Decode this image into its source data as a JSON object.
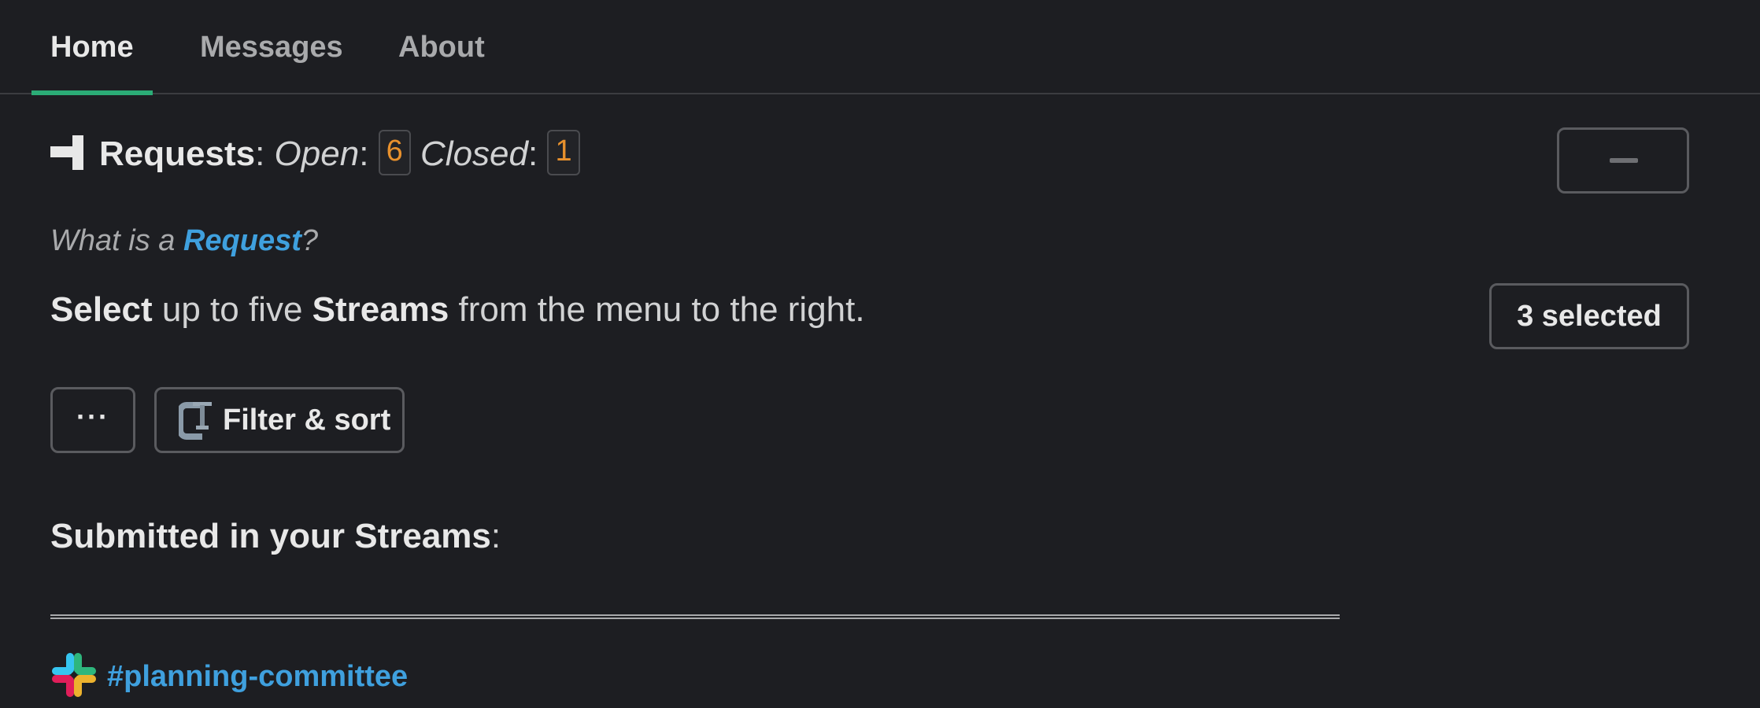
{
  "tabs": [
    {
      "label": "Home",
      "active": true
    },
    {
      "label": "Messages",
      "active": false
    },
    {
      "label": "About",
      "active": false
    }
  ],
  "header": {
    "requests_label": "Requests",
    "colon": ":",
    "open_label": "Open",
    "open_count": "6",
    "closed_label": "Closed",
    "closed_count": "1"
  },
  "help": {
    "prefix": "What is a ",
    "link": "Request",
    "suffix": "?"
  },
  "instruction": {
    "select": "Select",
    "middle": " up to five ",
    "streams": "Streams",
    "end": " from the menu to the right."
  },
  "streams_select": {
    "label": "3 selected"
  },
  "toolbar": {
    "more_label": "···",
    "filter_label": "Filter & sort"
  },
  "submitted": {
    "label": "Submitted in your Streams",
    "colon": ":"
  },
  "channel": {
    "label": "#planning-committee"
  },
  "colors": {
    "accent": "#2bac76",
    "link": "#3fa0de",
    "badge": "#e8912d",
    "background": "#1d1e22"
  },
  "icons": [
    "flag-icon",
    "minus-icon",
    "clamp-icon",
    "slack-icon"
  ]
}
